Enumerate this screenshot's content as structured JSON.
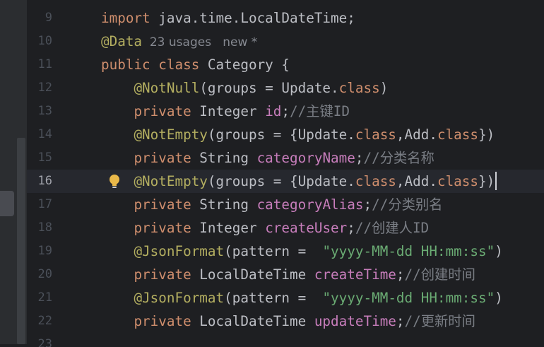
{
  "colors": {
    "background": "#1e1f22",
    "gutter": "#2b2d30",
    "line_number": "#4b5059",
    "current_line_number": "#a1a3ab",
    "current_line_bg": "#26282e",
    "keyword": "#cf8e6d",
    "annotation": "#b3ae60",
    "field": "#c77dbb",
    "string": "#6aab73",
    "comment": "#7a7e85",
    "plain": "#bcbec4",
    "hint": "#868991"
  },
  "editor": {
    "current_line": "16",
    "lines": [
      {
        "num": "9",
        "tokens": [
          {
            "t": "import",
            "c": "keyword"
          },
          {
            "t": " java.time.LocalDateTime;",
            "c": "plain"
          }
        ]
      },
      {
        "num": "10",
        "tokens": [
          {
            "t": "@Data",
            "c": "annotation"
          },
          {
            "t": "  23 usages   new *",
            "c": "hint"
          }
        ]
      },
      {
        "num": "11",
        "tokens": [
          {
            "t": "public",
            "c": "keyword"
          },
          {
            "t": " ",
            "c": "plain"
          },
          {
            "t": "class",
            "c": "keyword"
          },
          {
            "t": " Category {",
            "c": "plain"
          }
        ]
      },
      {
        "num": "12",
        "tokens": [
          {
            "t": "    ",
            "c": "plain"
          },
          {
            "t": "@NotNull",
            "c": "annotation"
          },
          {
            "t": "(groups = Update.",
            "c": "plain"
          },
          {
            "t": "class",
            "c": "keyword"
          },
          {
            "t": ")",
            "c": "plain"
          }
        ]
      },
      {
        "num": "13",
        "tokens": [
          {
            "t": "    ",
            "c": "plain"
          },
          {
            "t": "private",
            "c": "keyword"
          },
          {
            "t": " Integer ",
            "c": "plain"
          },
          {
            "t": "id",
            "c": "field"
          },
          {
            "t": ";",
            "c": "plain"
          },
          {
            "t": "//主键ID",
            "c": "comment"
          }
        ]
      },
      {
        "num": "14",
        "tokens": [
          {
            "t": "    ",
            "c": "plain"
          },
          {
            "t": "@NotEmpty",
            "c": "annotation"
          },
          {
            "t": "(groups = {Update.",
            "c": "plain"
          },
          {
            "t": "class",
            "c": "keyword"
          },
          {
            "t": ",Add.",
            "c": "plain"
          },
          {
            "t": "class",
            "c": "keyword"
          },
          {
            "t": "})",
            "c": "plain"
          }
        ]
      },
      {
        "num": "15",
        "tokens": [
          {
            "t": "    ",
            "c": "plain"
          },
          {
            "t": "private",
            "c": "keyword"
          },
          {
            "t": " String ",
            "c": "plain"
          },
          {
            "t": "categoryName",
            "c": "field"
          },
          {
            "t": ";",
            "c": "plain"
          },
          {
            "t": "//分类名称",
            "c": "comment"
          }
        ]
      },
      {
        "num": "16",
        "tokens": [
          {
            "t": "    ",
            "c": "plain"
          },
          {
            "t": "@NotEmpty",
            "c": "annotation"
          },
          {
            "t": "(groups = {Update.",
            "c": "plain"
          },
          {
            "t": "class",
            "c": "keyword"
          },
          {
            "t": ",Add.",
            "c": "plain"
          },
          {
            "t": "class",
            "c": "keyword"
          },
          {
            "t": "})",
            "c": "plain"
          }
        ],
        "current": true,
        "bulb": true
      },
      {
        "num": "17",
        "tokens": [
          {
            "t": "    ",
            "c": "plain"
          },
          {
            "t": "private",
            "c": "keyword"
          },
          {
            "t": " String ",
            "c": "plain"
          },
          {
            "t": "categoryAlias",
            "c": "field"
          },
          {
            "t": ";",
            "c": "plain"
          },
          {
            "t": "//分类别名",
            "c": "comment"
          }
        ]
      },
      {
        "num": "18",
        "tokens": [
          {
            "t": "    ",
            "c": "plain"
          },
          {
            "t": "private",
            "c": "keyword"
          },
          {
            "t": " Integer ",
            "c": "plain"
          },
          {
            "t": "createUser",
            "c": "field"
          },
          {
            "t": ";",
            "c": "plain"
          },
          {
            "t": "//创建人ID",
            "c": "comment"
          }
        ]
      },
      {
        "num": "19",
        "tokens": [
          {
            "t": "    ",
            "c": "plain"
          },
          {
            "t": "@JsonFormat",
            "c": "annotation"
          },
          {
            "t": "(pattern =  ",
            "c": "plain"
          },
          {
            "t": "\"yyyy-MM-dd HH:mm:ss\"",
            "c": "string"
          },
          {
            "t": ")",
            "c": "plain"
          }
        ]
      },
      {
        "num": "20",
        "tokens": [
          {
            "t": "    ",
            "c": "plain"
          },
          {
            "t": "private",
            "c": "keyword"
          },
          {
            "t": " LocalDateTime ",
            "c": "plain"
          },
          {
            "t": "createTime",
            "c": "field"
          },
          {
            "t": ";",
            "c": "plain"
          },
          {
            "t": "//创建时间",
            "c": "comment"
          }
        ]
      },
      {
        "num": "21",
        "tokens": [
          {
            "t": "    ",
            "c": "plain"
          },
          {
            "t": "@JsonFormat",
            "c": "annotation"
          },
          {
            "t": "(pattern =  ",
            "c": "plain"
          },
          {
            "t": "\"yyyy-MM-dd HH:mm:ss\"",
            "c": "string"
          },
          {
            "t": ")",
            "c": "plain"
          }
        ]
      },
      {
        "num": "22",
        "tokens": [
          {
            "t": "    ",
            "c": "plain"
          },
          {
            "t": "private",
            "c": "keyword"
          },
          {
            "t": " LocalDateTime ",
            "c": "plain"
          },
          {
            "t": "updateTime",
            "c": "field"
          },
          {
            "t": ";",
            "c": "plain"
          },
          {
            "t": "//更新时间",
            "c": "comment"
          }
        ]
      },
      {
        "num": "23",
        "tokens": [],
        "cut": true
      }
    ]
  }
}
